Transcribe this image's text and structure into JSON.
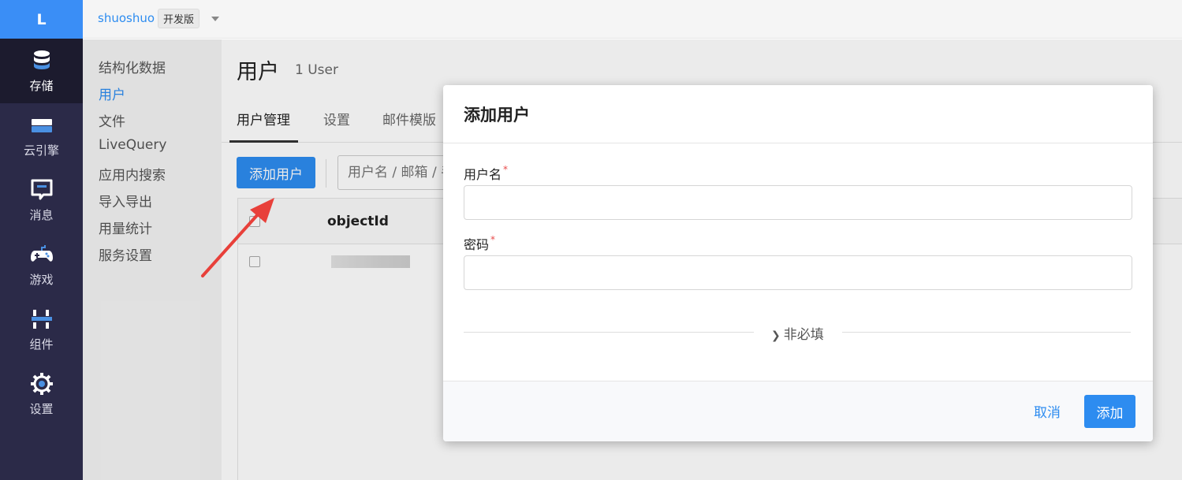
{
  "rail": {
    "logo": "L",
    "items": [
      {
        "label": "存储",
        "icon": "database-icon",
        "active": true
      },
      {
        "label": "云引擎",
        "icon": "server-icon"
      },
      {
        "label": "消息",
        "icon": "message-icon"
      },
      {
        "label": "游戏",
        "icon": "gamepad-icon"
      },
      {
        "label": "组件",
        "icon": "components-icon"
      },
      {
        "label": "设置",
        "icon": "gear-icon"
      }
    ]
  },
  "topbar": {
    "app_name": "shuoshuo",
    "plan_badge": "开发版"
  },
  "subnav": {
    "items": [
      {
        "label": "结构化数据"
      },
      {
        "label": "用户",
        "active": true
      },
      {
        "label": "文件"
      },
      {
        "label": "LiveQuery"
      },
      {
        "label": "应用内搜索"
      },
      {
        "label": "导入导出"
      },
      {
        "label": "用量统计"
      },
      {
        "label": "服务设置"
      }
    ]
  },
  "main": {
    "title": "用户",
    "count": "1 User",
    "tabs": [
      {
        "label": "用户管理",
        "active": true
      },
      {
        "label": "设置"
      },
      {
        "label": "邮件模版"
      }
    ],
    "add_button": "添加用户",
    "search_placeholder": "用户名 / 邮箱 / 手机号",
    "table": {
      "columns": [
        "objectId"
      ],
      "rows": 1
    }
  },
  "modal": {
    "title": "添加用户",
    "fields": [
      {
        "label": "用户名",
        "required_mark": "*",
        "value": ""
      },
      {
        "label": "密码",
        "required_mark": "*",
        "value": ""
      }
    ],
    "optional_toggle": "非必填",
    "cancel": "取消",
    "submit": "添加"
  },
  "colors": {
    "accent": "#2d8cf0",
    "rail_bg": "#2b2a48",
    "logo_bg": "#3a8ef6",
    "annotation_arrow": "#e8403a"
  }
}
